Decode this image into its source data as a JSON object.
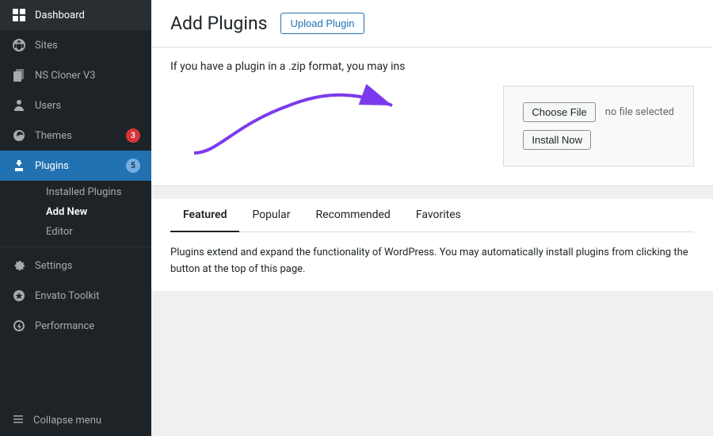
{
  "sidebar": {
    "items": [
      {
        "id": "dashboard",
        "label": "Dashboard",
        "icon": "⊞",
        "badge": null,
        "active": false
      },
      {
        "id": "sites",
        "label": "Sites",
        "icon": "🏠",
        "badge": null,
        "active": false
      },
      {
        "id": "ns-cloner",
        "label": "NS Cloner V3",
        "icon": "⧉",
        "badge": null,
        "active": false
      },
      {
        "id": "users",
        "label": "Users",
        "icon": "👤",
        "badge": null,
        "active": false
      },
      {
        "id": "themes",
        "label": "Themes",
        "icon": "🎨",
        "badge": "3",
        "badgeColor": "red",
        "active": false
      },
      {
        "id": "plugins",
        "label": "Plugins",
        "icon": "🔌",
        "badge": "5",
        "badgeColor": "blue",
        "active": true
      },
      {
        "id": "settings",
        "label": "Settings",
        "icon": "⚙",
        "badge": null,
        "active": false
      },
      {
        "id": "envato-toolkit",
        "label": "Envato Toolkit",
        "icon": "📦",
        "badge": null,
        "active": false
      },
      {
        "id": "performance",
        "label": "Performance",
        "icon": "⏱",
        "badge": null,
        "active": false
      }
    ],
    "plugins_sub": [
      {
        "id": "installed-plugins",
        "label": "Installed Plugins",
        "active": false
      },
      {
        "id": "add-new",
        "label": "Add New",
        "active": true
      },
      {
        "id": "editor",
        "label": "Editor",
        "active": false
      }
    ],
    "collapse_label": "Collapse menu"
  },
  "header": {
    "title": "Add Plugins",
    "upload_button": "Upload Plugin"
  },
  "upload": {
    "description": "If you have a plugin in a .zip format, you may ins",
    "choose_file_label": "Choose File",
    "no_file_text": "no file selected",
    "install_now_label": "Install Now"
  },
  "tabs": [
    {
      "id": "featured",
      "label": "Featured",
      "active": true
    },
    {
      "id": "popular",
      "label": "Popular",
      "active": false
    },
    {
      "id": "recommended",
      "label": "Recommended",
      "active": false
    },
    {
      "id": "favorites",
      "label": "Favorites",
      "active": false
    }
  ],
  "tab_content": {
    "text": "Plugins extend and expand the functionality of WordPress. You may automatically install plugins from clicking the button at the top of this page."
  }
}
